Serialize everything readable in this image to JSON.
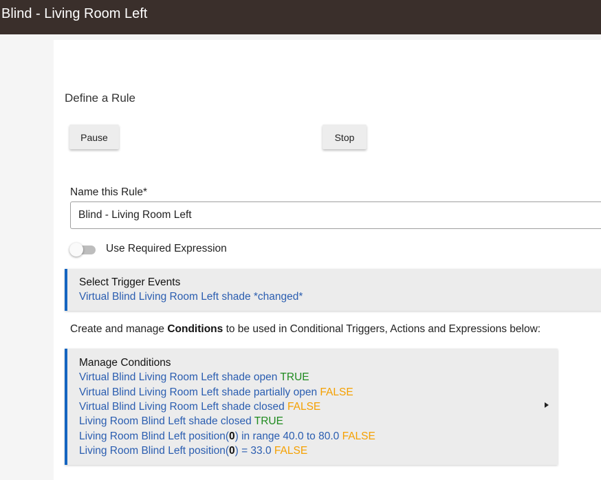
{
  "header": {
    "title": "Blind - Living Room Left",
    "background_color": "#3a2f2b"
  },
  "main": {
    "heading": "Define a Rule",
    "buttons": {
      "pause_label": "Pause",
      "stop_label": "Stop"
    },
    "name_field": {
      "label": "Name this Rule*",
      "value": "Blind - Living Room Left"
    },
    "required_expression": {
      "label": "Use Required Expression",
      "enabled": false
    },
    "trigger_panel": {
      "title": "Select Trigger Events",
      "line": "Virtual Blind Living Room Left shade *changed*"
    },
    "conditions_description": {
      "before": "Create and manage ",
      "bold": "Conditions",
      "after": " to be used in Conditional Triggers, Actions and Expressions below:"
    },
    "conditions_panel": {
      "title": "Manage Conditions",
      "items": [
        {
          "text": "Virtual Blind Living Room Left shade open ",
          "status": "TRUE"
        },
        {
          "text": "Virtual Blind Living Room Left shade partially open ",
          "status": "FALSE"
        },
        {
          "text": "Virtual Blind Living Room Left shade closed ",
          "status": "FALSE"
        },
        {
          "text": "Living Room Blind Left shade closed ",
          "status": "TRUE"
        },
        {
          "text_before": "Living Room Blind Left position(",
          "paren_value": "0",
          "text_after": ") in range 40.0 to 80.0 ",
          "status": "FALSE"
        },
        {
          "text_before": "Living Room Blind Left position(",
          "paren_value": "0",
          "text_after": ") = 33.0 ",
          "status": "FALSE"
        }
      ],
      "expand_icon": "triangle-right-icon"
    }
  },
  "colors": {
    "accent_border": "#1565c0",
    "link_text": "#2a5db0",
    "true_status": "#1e8a1e",
    "false_status": "#f5a000"
  }
}
